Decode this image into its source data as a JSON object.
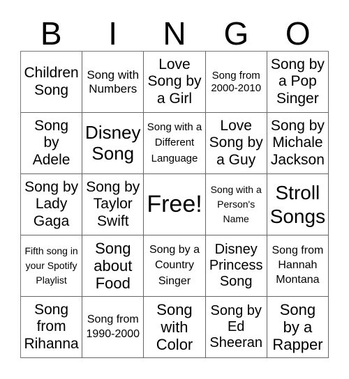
{
  "header": {
    "letters": [
      "B",
      "I",
      "N",
      "G",
      "O"
    ]
  },
  "cells": [
    [
      "Children Song",
      "Song with Numbers",
      "Love Song by a Girl",
      "Song from 2000-2010",
      "Song by a Pop Singer"
    ],
    [
      "Song by Adele",
      "Disney Song",
      "Song with a Different Language",
      "Love Song by a Guy",
      "Song by Michale Jackson"
    ],
    [
      "Song by Lady Gaga",
      "Song by Taylor Swift",
      "Free!",
      "Song with a Person's Name",
      "Stroll Songs"
    ],
    [
      "Fifth song in your Spotify Playlist",
      "Song about Food",
      "Song by a Country Singer",
      "Disney Princess Song",
      "Song from Hannah Montana"
    ],
    [
      "Song from Rihanna",
      "Song from 1990-2000",
      "Song with Color",
      "Song by Ed Sheeran",
      "Song by a Rapper"
    ]
  ]
}
